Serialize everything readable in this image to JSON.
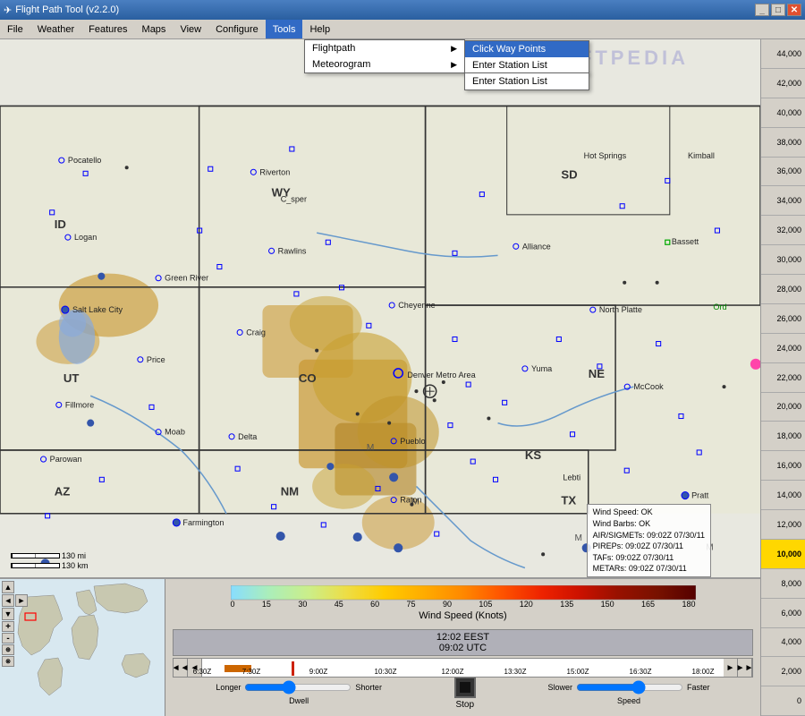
{
  "titlebar": {
    "title": "Flight Path Tool (v2.2.0)",
    "icon": "✈",
    "controls": {
      "min": "_",
      "max": "□",
      "close": "✕"
    }
  },
  "menubar": {
    "items": [
      "File",
      "Weather",
      "Features",
      "Maps",
      "View",
      "Configure",
      "Tools",
      "Help"
    ]
  },
  "tools_menu": {
    "flightpath_label": "Flightpath",
    "meteorogram_label": "Meteorogram",
    "flightpath_submenu": [
      "Click Way Points",
      "Enter Station List"
    ],
    "meteorogram_submenu": [
      "Enter Station List"
    ]
  },
  "scale_values": [
    "44,000",
    "42,000",
    "40,000",
    "38,000",
    "36,000",
    "34,000",
    "32,000",
    "30,000",
    "28,000",
    "26,000",
    "24,000",
    "22,000",
    "20,000",
    "18,000",
    "16,000",
    "14,000",
    "12,000",
    "10,000",
    "8,000",
    "6,000",
    "4,000",
    "2,000",
    "0"
  ],
  "highlighted_scale": "10,000",
  "status_info": {
    "wind_speed": "Wind Speed: OK",
    "wind_barbs": "Wind Barbs: OK",
    "airsigmets": "AIR/SIGMETs: 09:02Z 07/30/11",
    "pireps": "PIREPs: 09:02Z 07/30/11",
    "tafs": "TAFs: 09:02Z 07/30/11",
    "metars": "METARs: 09:02Z 07/30/11"
  },
  "wind_legend": {
    "title": "Wind Speed (Knots)",
    "values": [
      "0",
      "15",
      "30",
      "45",
      "60",
      "75",
      "90",
      "105",
      "120",
      "135",
      "150",
      "165",
      "180"
    ]
  },
  "time_display": {
    "local_time": "12:02 EEST",
    "utc_time": "09:02 UTC"
  },
  "timeline": {
    "times": [
      "6:30Z",
      "7:30Z",
      "9:00Z",
      "10:30Z",
      "12:00Z",
      "13:30Z",
      "15:00Z",
      "16:30Z",
      "18:00Z"
    ]
  },
  "controls": {
    "dwell_label": "Dwell",
    "longer_label": "Longer",
    "shorter_label": "Shorter",
    "stop_label": "Stop",
    "speed_label": "Speed",
    "slower_label": "Slower",
    "faster_label": "Faster"
  },
  "map": {
    "regions": [
      "ID",
      "WY",
      "SD",
      "UT",
      "CO",
      "KS",
      "NM",
      "AZ",
      "TX"
    ],
    "cities": [
      "Pocatello",
      "Logan",
      "Salt Lake City",
      "Green River",
      "Price",
      "Fillmore",
      "Moab",
      "Parowan",
      "Farmington",
      "Riverton",
      "Rawlins",
      "Craig",
      "Delta",
      "Cheyenne",
      "Denver Metro Area",
      "Pueblo",
      "Raton",
      "Alliance",
      "Bassett",
      "North Platte",
      "Yuma",
      "McCook",
      "Pratt",
      "Lebti",
      "Hot Springs",
      "Kimball",
      "Ord"
    ]
  },
  "distance_scale": {
    "miles": "130 mi",
    "km": "130 km"
  },
  "watermark": "SOFTPEDIA"
}
